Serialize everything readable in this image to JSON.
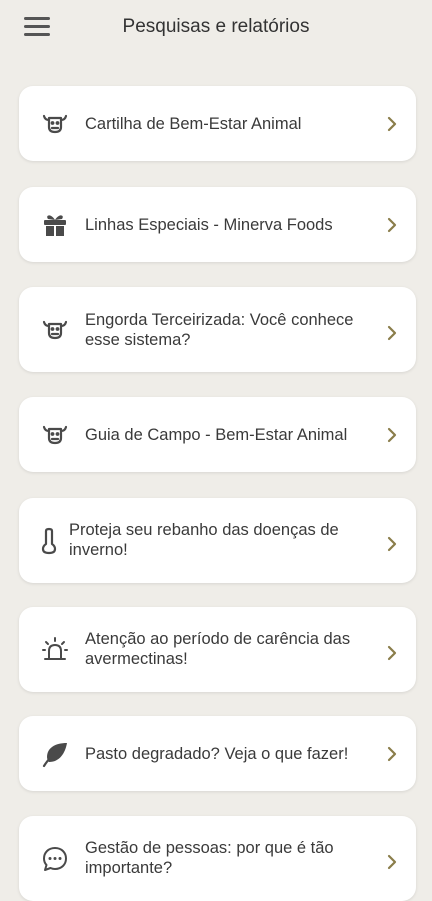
{
  "header": {
    "title": "Pesquisas e relatórios",
    "menu_icon": "hamburger-menu-icon"
  },
  "items": [
    {
      "label": "Cartilha de Bem-Estar Animal",
      "icon": "cow-icon"
    },
    {
      "label": "Linhas Especiais - Minerva Foods",
      "icon": "gift-icon"
    },
    {
      "label": "Engorda Terceirizada: Você conhece esse sistema?",
      "icon": "cow-icon"
    },
    {
      "label": "Guia de Campo - Bem-Estar Animal",
      "icon": "cow-icon"
    },
    {
      "label": "Proteja seu rebanho das doenças de inverno!",
      "icon": "thermometer-icon"
    },
    {
      "label": "Atenção ao período de carência das avermectinas!",
      "icon": "alarm-light-icon"
    },
    {
      "label": "Pasto degradado? Veja o que fazer!",
      "icon": "leaf-icon"
    },
    {
      "label": "Gestão de pessoas: por que é tão importante?",
      "icon": "chat-bubble-icon"
    }
  ],
  "colors": {
    "background": "#efede8",
    "card": "#ffffff",
    "chevron": "#8a7d4a",
    "icon": "#4a4a4a"
  }
}
